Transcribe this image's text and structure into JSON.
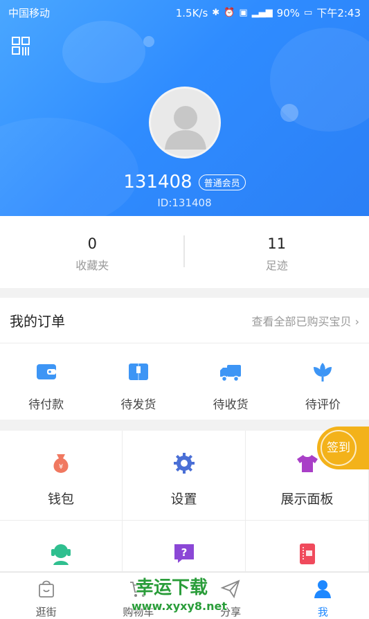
{
  "status_bar": {
    "carrier": "中国移动",
    "speed": "1.5K/s",
    "battery": "90%",
    "time": "下午2:43",
    "icons": [
      "bluetooth-icon",
      "alarm-icon",
      "hd-icon",
      "4g-signal-icon",
      "battery-icon"
    ]
  },
  "profile": {
    "username": "131408",
    "member_level": "普通会员",
    "user_id": "ID:131408"
  },
  "stats": [
    {
      "value": "0",
      "label": "收藏夹"
    },
    {
      "value": "11",
      "label": "足迹"
    }
  ],
  "orders": {
    "title": "我的订单",
    "view_all": "查看全部已购买宝贝 ›",
    "items": [
      {
        "label": "待付款",
        "icon": "wallet-icon"
      },
      {
        "label": "待发货",
        "icon": "package-icon"
      },
      {
        "label": "待收货",
        "icon": "truck-icon"
      },
      {
        "label": "待评价",
        "icon": "flower-icon"
      }
    ]
  },
  "grid": {
    "items": [
      {
        "label": "钱包",
        "icon": "money-bag-icon"
      },
      {
        "label": "设置",
        "icon": "gear-icon"
      },
      {
        "label": "展示面板",
        "icon": "shirt-icon"
      }
    ],
    "lower_icons": [
      "customer-service-icon",
      "help-icon",
      "ticket-icon"
    ]
  },
  "signin": {
    "label": "签到"
  },
  "tabbar": {
    "tabs": [
      {
        "label": "逛街",
        "icon": "shopping-bag-icon"
      },
      {
        "label": "购物车",
        "icon": "cart-icon"
      },
      {
        "label": "分享",
        "icon": "share-icon"
      },
      {
        "label": "我",
        "icon": "user-icon"
      }
    ],
    "active": "我"
  },
  "watermark": {
    "title": "幸运下载",
    "url": "www.xyxy8.net"
  },
  "colors": {
    "primary": "#2f8cff",
    "accent": "#f3b21a",
    "tab_active": "#1e88ff"
  }
}
